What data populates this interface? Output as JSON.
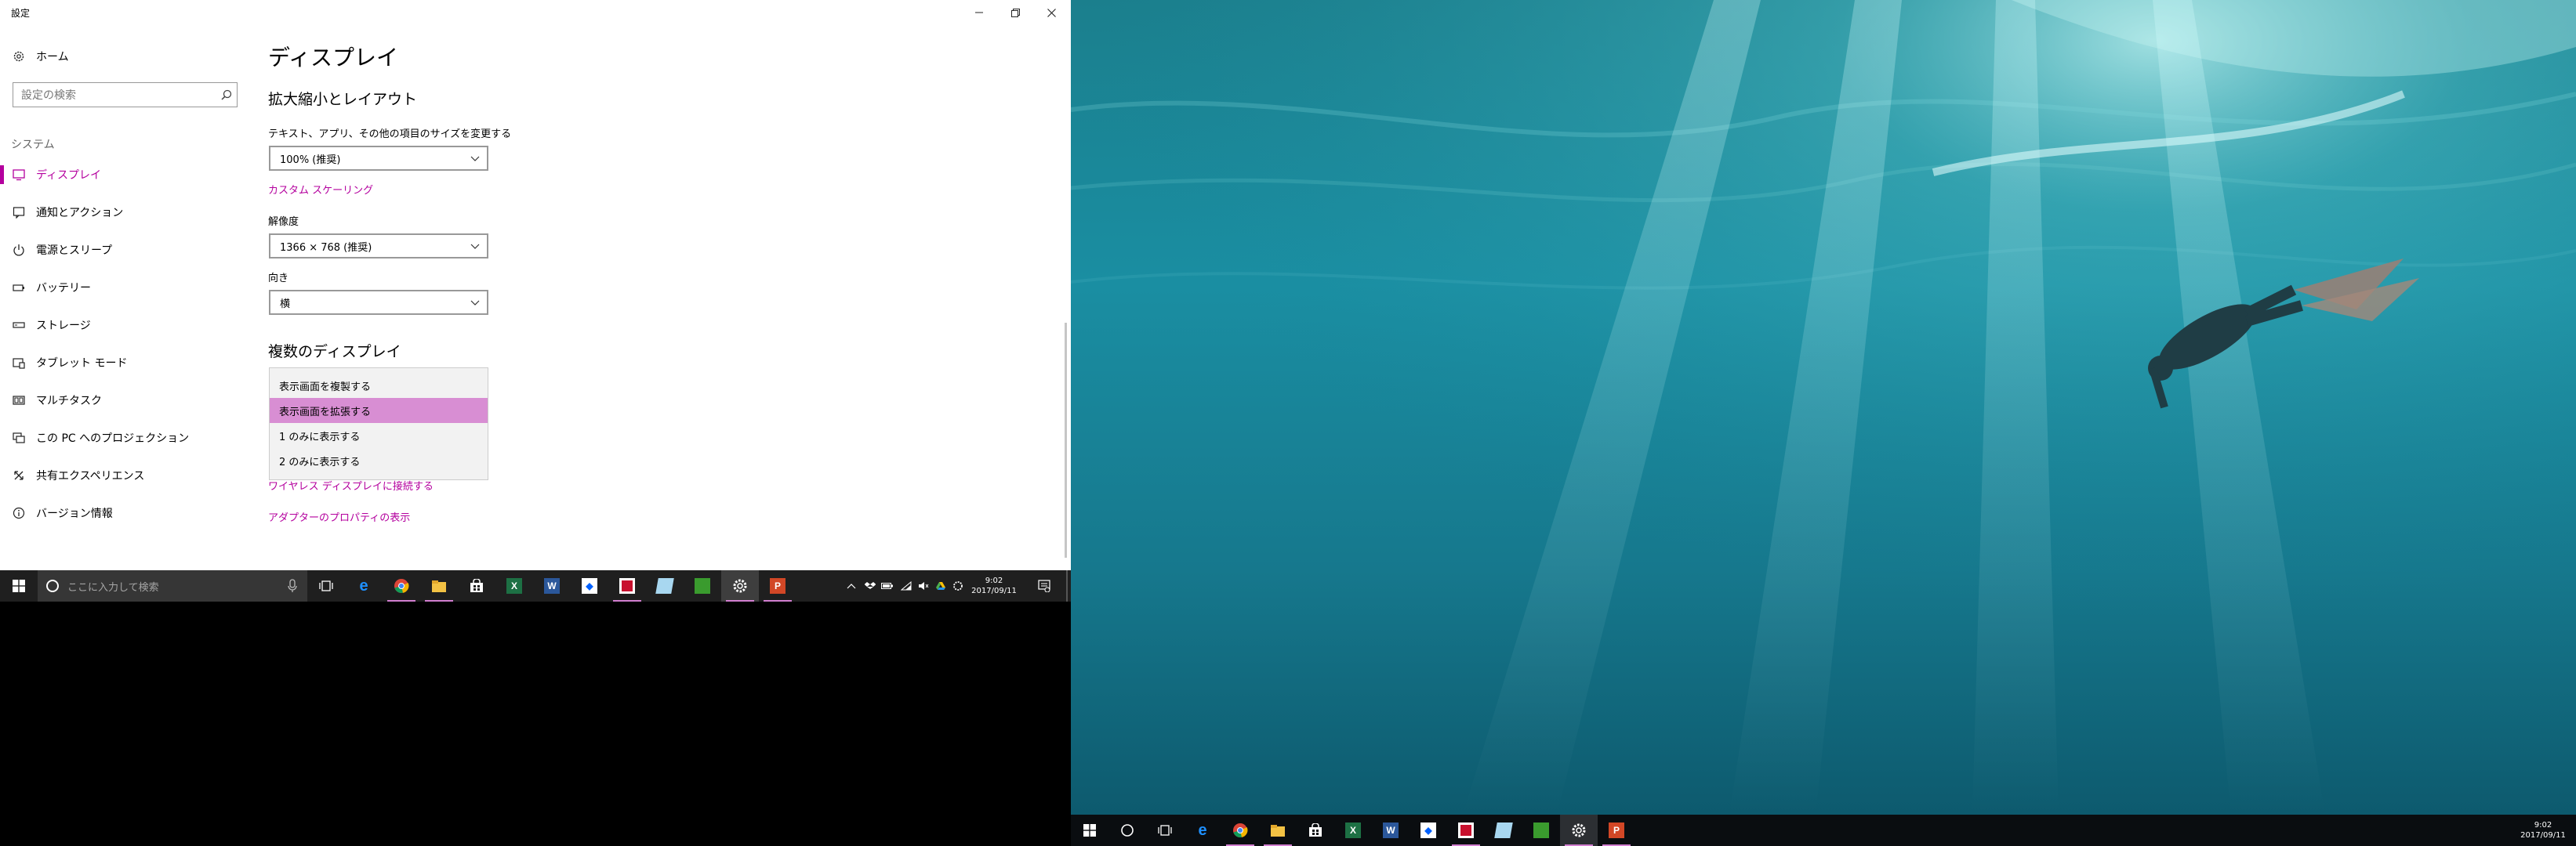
{
  "window": {
    "title": "設定"
  },
  "nav": {
    "home": "ホーム",
    "search_placeholder": "設定の検索",
    "section": "システム",
    "items": [
      {
        "label": "ディスプレイ",
        "icon": "monitor-icon",
        "selected": true
      },
      {
        "label": "通知とアクション",
        "icon": "notification-icon"
      },
      {
        "label": "電源とスリープ",
        "icon": "power-icon"
      },
      {
        "label": "バッテリー",
        "icon": "battery-icon"
      },
      {
        "label": "ストレージ",
        "icon": "storage-icon"
      },
      {
        "label": "タブレット モード",
        "icon": "tablet-icon"
      },
      {
        "label": "マルチタスク",
        "icon": "multitask-icon"
      },
      {
        "label": "この PC へのプロジェクション",
        "icon": "projection-icon"
      },
      {
        "label": "共有エクスペリエンス",
        "icon": "shared-icon"
      },
      {
        "label": "バージョン情報",
        "icon": "info-icon"
      }
    ]
  },
  "main": {
    "title": "ディスプレイ",
    "scale_section": "拡大縮小とレイアウト",
    "scale_label": "テキスト、アプリ、その他の項目のサイズを変更する",
    "scale_value": "100% (推奨)",
    "custom_scaling_link": "カスタム スケーリング",
    "resolution_label": "解像度",
    "resolution_value": "1366 × 768 (推奨)",
    "orientation_label": "向き",
    "orientation_value": "横",
    "multi_section": "複数のディスプレイ",
    "multi_options": [
      "表示画面を複製する",
      "表示画面を拡張する",
      "1 のみに表示する",
      "2 のみに表示する"
    ],
    "multi_selected_index": 1,
    "wireless_link": "ワイヤレス ディスプレイに接続する",
    "adapter_link": "アダプターのプロパティの表示"
  },
  "taskbar": {
    "search_placeholder": "ここに入力して検索",
    "time": "9:02",
    "date": "2017/09/11",
    "apps": [
      "edge-icon",
      "chrome-icon",
      "file-explorer-icon",
      "store-icon",
      "excel-icon",
      "word-icon",
      "dropbox-icon",
      "app-red-icon",
      "notepad-icon",
      "green-app-icon",
      "settings-icon",
      "powerpoint-icon"
    ]
  },
  "colors": {
    "accent": "#b4009e",
    "selection": "#d88ed3",
    "taskbar": "#1f1f1f"
  }
}
